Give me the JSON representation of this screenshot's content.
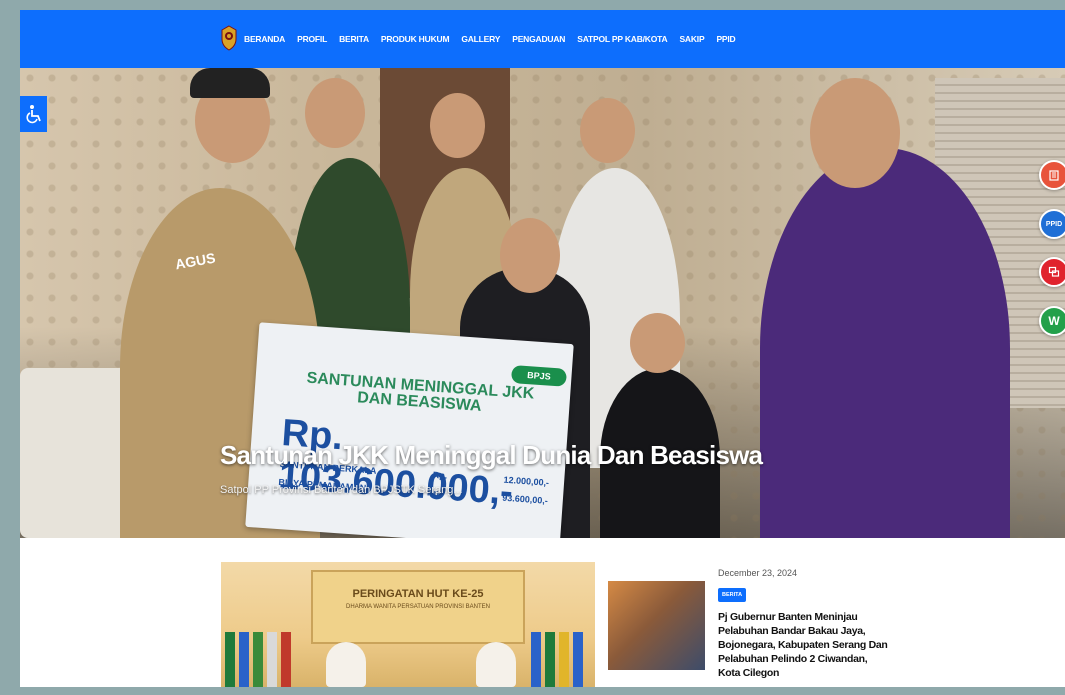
{
  "nav": {
    "items": [
      "BERANDA",
      "PROFIL",
      "BERITA",
      "PRODUK HUKUM",
      "GALLERY",
      "PENGADUAN",
      "SATPOL PP KAB/KOTA",
      "SAKIP",
      "PPID"
    ]
  },
  "hero": {
    "title": "Santunan JKK Meninggal Dunia Dan Beasiswa",
    "subtitle": "Satpol PP Provinsi Banten dan BPJSTK Serang...",
    "name_tag": "AGUS",
    "board": {
      "title": "SANTUNAN MENINGGAL JKK DAN BEASISWA",
      "amount": "Rp. 103.600.000,-",
      "rows": [
        {
          "label": "SANTUNAN BERKALA",
          "currency": "Rp.",
          "value": "12.000,00,-"
        },
        {
          "label": "BIAYA PEMAKAMAN",
          "currency": "Rp.",
          "value": "93.600,00,-"
        }
      ],
      "logo": "BPJS"
    }
  },
  "side_icons": [
    {
      "label": "",
      "color": "#e8533b"
    },
    {
      "label": "PPID",
      "color": "#1f6fd6"
    },
    {
      "label": "",
      "color": "#e0232d"
    },
    {
      "label": "W",
      "color": "#23a04a"
    }
  ],
  "feature": {
    "banner_title": "PERINGATAN HUT KE-25",
    "banner_sub": "DHARMA WANITA PERSATUAN PROVINSI BANTEN"
  },
  "news": {
    "date": "December 23, 2024",
    "badge": "BERITA",
    "title": "Pj Gubernur Banten Meninjau Pelabuhan Bandar Bakau Jaya, Bojonegara, Kabupaten Serang Dan Pelabuhan Pelindo 2 Ciwandan, Kota Cilegon"
  },
  "colors": {
    "primary": "#0d6efd",
    "page_bg": "#8fa9ab"
  }
}
